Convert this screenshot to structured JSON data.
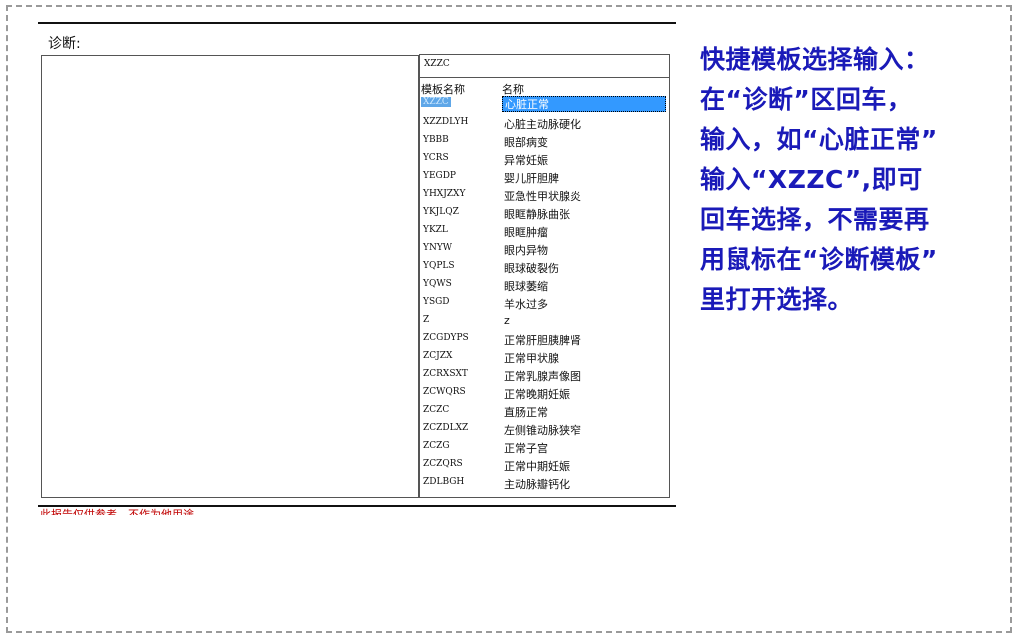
{
  "diagnosis": {
    "label": "诊断:",
    "text_value": ""
  },
  "template_picker": {
    "input_value": "XZZC",
    "headers": [
      "模板名称",
      "名称"
    ],
    "rows": [
      {
        "code": "XZZC",
        "name": "心脏正常",
        "selected": true
      },
      {
        "code": "XZZDLYH",
        "name": "心脏主动脉硬化"
      },
      {
        "code": "YBBB",
        "name": "眼部病变"
      },
      {
        "code": "YCRS",
        "name": "异常妊娠"
      },
      {
        "code": "YEGDP",
        "name": "婴儿肝胆脾"
      },
      {
        "code": "YHXJZXY",
        "name": "亚急性甲状腺炎"
      },
      {
        "code": "YKJLQZ",
        "name": "眼眶静脉曲张"
      },
      {
        "code": "YKZL",
        "name": "眼眶肿瘤"
      },
      {
        "code": "YNYW",
        "name": "眼内异物"
      },
      {
        "code": "YQPLS",
        "name": "眼球破裂伤"
      },
      {
        "code": "YQWS",
        "name": "眼球萎缩"
      },
      {
        "code": "YSGD",
        "name": "羊水过多"
      },
      {
        "code": "Z",
        "name": "z"
      },
      {
        "code": "ZCGDYPS",
        "name": "正常肝胆胰脾肾"
      },
      {
        "code": "ZCJZX",
        "name": "正常甲状腺"
      },
      {
        "code": "ZCRXSXT",
        "name": "正常乳腺声像图"
      },
      {
        "code": "ZCWQRS",
        "name": "正常晚期妊娠"
      },
      {
        "code": "ZCZC",
        "name": "直肠正常"
      },
      {
        "code": "ZCZDLXZ",
        "name": "左侧锥动脉狭窄"
      },
      {
        "code": "ZCZG",
        "name": "正常子宫"
      },
      {
        "code": "ZCZQRS",
        "name": "正常中期妊娠"
      },
      {
        "code": "ZDLBGH",
        "name": "主动脉瓣钙化"
      }
    ]
  },
  "footer_note": "此报告仅供参考，不作为他用途",
  "instruction": {
    "lines": [
      "快捷模板选择输入：",
      "在“诊断”区回车，",
      "输入，如“心脏正常”",
      "输入“XZZC”,即可",
      "回车选择，不需要再",
      "用鼠标在“诊断模板”",
      "里打开选择。"
    ],
    "color": "#1a1ab8"
  }
}
